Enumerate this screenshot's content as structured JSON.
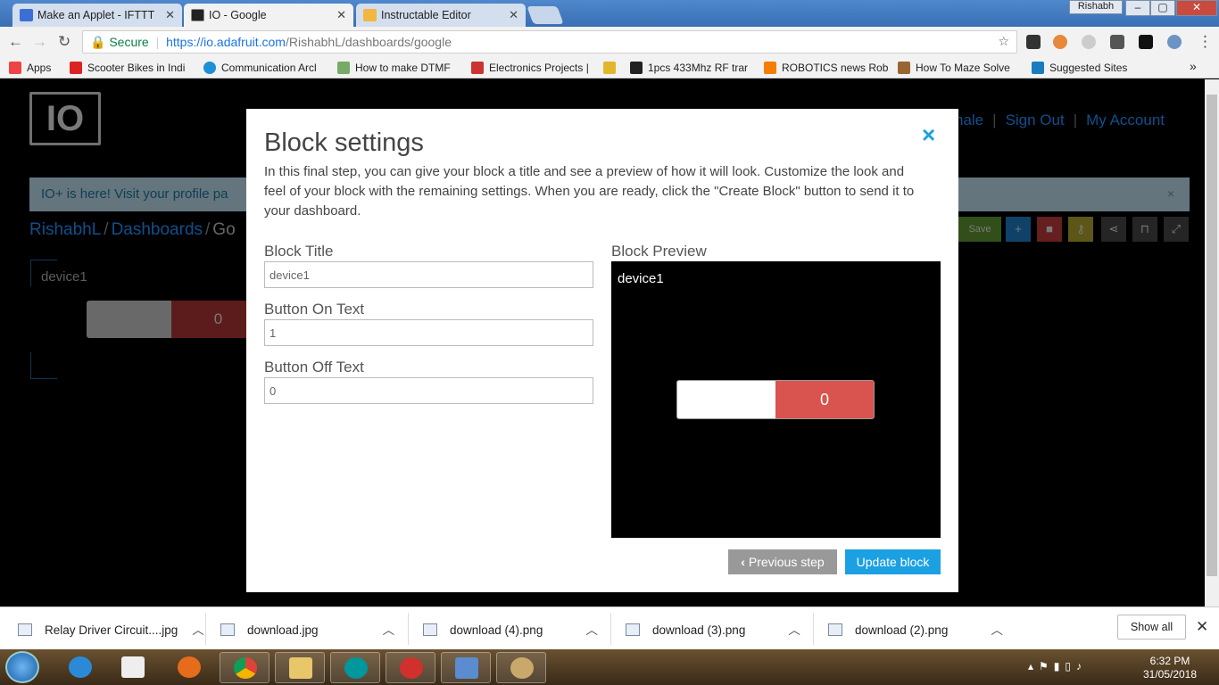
{
  "browser": {
    "tabs": [
      {
        "title": "Make an Applet - IFTTT",
        "color": "#3b6fd6"
      },
      {
        "title": "IO - Google",
        "color": "#222222",
        "active": true
      },
      {
        "title": "Instructable Editor",
        "color": "#f3b63f"
      }
    ],
    "profile": "Rishabh",
    "window_controls": {
      "minimize": "–",
      "maximize": "▢",
      "close": "✕"
    },
    "address": {
      "secure_label": "Secure",
      "host": "https://io.adafruit.com",
      "path": "/RishabhL/dashboards/google"
    },
    "bookmarks": [
      {
        "label": "Apps",
        "icon": "apps-grid-icon",
        "color": "#e44"
      },
      {
        "label": "Scooter Bikes in Indi",
        "icon": "scooter-icon",
        "color": "#d22"
      },
      {
        "label": "Communication Arcl",
        "icon": "e-icon",
        "color": "#1f8fd6"
      },
      {
        "label": "How to make DTMF",
        "icon": "dtmf-icon",
        "color": "#7a6"
      },
      {
        "label": "Electronics Projects |",
        "icon": "electronics-icon",
        "color": "#c33"
      },
      {
        "label": "1pcs 433Mhz RF trar",
        "icon": "amazon-icon",
        "color": "#222"
      },
      {
        "label": "ROBOTICS news Rob",
        "icon": "blogger-icon",
        "color": "#f57d00"
      },
      {
        "label": "How To Maze Solve",
        "icon": "maze-icon",
        "color": "#963"
      },
      {
        "label": "Suggested Sites",
        "icon": "bing-icon",
        "color": "#1a7bbf"
      }
    ],
    "bookmarks_overflow": "»"
  },
  "site": {
    "logo_text": "IO",
    "nav": {
      "partial": "nale",
      "sign_out": "Sign Out",
      "my_account": "My Account",
      "separator": "|"
    },
    "banner": {
      "text": "IO+ is here! Visit your profile pa",
      "close": "×"
    },
    "breadcrumb": {
      "user": "RishabhL",
      "dashboards": "Dashboards",
      "current": "Go",
      "separator": "/"
    },
    "toolbar": {
      "save": "Save"
    },
    "block": {
      "title": "device1",
      "off_text": "0"
    }
  },
  "modal": {
    "title": "Block settings",
    "close_label": "×",
    "description": "In this final step, you can give your block a title and see a preview of how it will look. Customize the look and feel of your block with the remaining settings. When you are ready, click the \"Create Block\" button to send it to your dashboard.",
    "fields": {
      "block_title": {
        "label": "Block Title",
        "value": "device1"
      },
      "on_text": {
        "label": "Button On Text",
        "value": "1"
      },
      "off_text": {
        "label": "Button Off Text",
        "value": "0"
      }
    },
    "preview": {
      "label": "Block Preview",
      "title": "device1",
      "off_value": "0"
    },
    "buttons": {
      "previous": "Previous step",
      "update": "Update block"
    }
  },
  "downloads": {
    "items": [
      "Relay Driver Circuit....jpg",
      "download.jpg",
      "download (4).png",
      "download (3).png",
      "download (2).png"
    ],
    "show_all": "Show all",
    "close": "✕"
  },
  "taskbar": {
    "clock_time": "6:32 PM",
    "clock_date": "31/05/2018",
    "apps": [
      "internet-explorer-icon",
      "media-player-icon",
      "firefox-icon",
      "chrome-icon",
      "file-explorer-icon",
      "arduino-icon",
      "app-red-icon",
      "photos-icon",
      "paint-icon"
    ]
  }
}
